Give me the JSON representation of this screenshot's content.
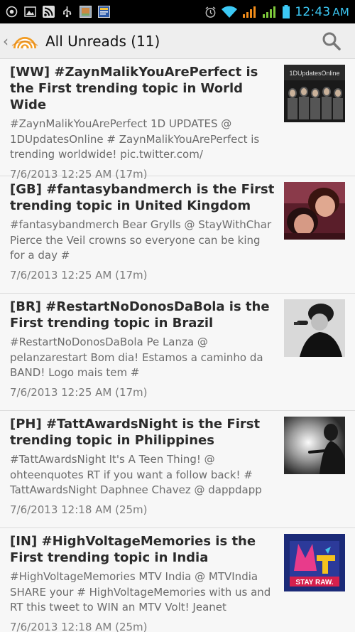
{
  "status_bar": {
    "time": "12:43",
    "ampm": "AM"
  },
  "action_bar": {
    "back_glyph": "‹",
    "title": "All Unreads (11)"
  },
  "items": [
    {
      "title": "[WW] #ZaynMalikYouArePerfect is the First trending topic in World Wide",
      "body": "#ZaynMalikYouArePerfect 1D UPDATES @ 1DUpdatesOnline # ZaynMalikYouArePerfect is trending worldwide! pic.twitter.com/",
      "time": "7/6/2013 12:25 AM (17m)",
      "thumb_text": "1DUpdatesOnline"
    },
    {
      "title": "[GB] #fantasybandmerch is the First trending topic in United Kingdom",
      "body": "#fantasybandmerch Bear Grylls  @ StayWithChar Pierce the Veil crowns so everyone can be king for a day #",
      "time": "7/6/2013 12:25 AM (17m)"
    },
    {
      "title": "[BR] #RestartNoDonosDaBola is the First trending topic in Brazil",
      "body": "#RestartNoDonosDaBola Pe Lanza  @ pelanzarestart Bom dia! Estamos a caminho da BAND! Logo mais tem #",
      "time": "7/6/2013 12:25 AM (17m)"
    },
    {
      "title": "[PH] #TattAwardsNight is the First trending topic in Philippines",
      "body": "#TattAwardsNight It's A Teen Thing!  @ ohteenquotes RT if you want a follow back! # TattAwardsNight Daphnee Chavez  @ dappdapp",
      "time": "7/6/2013 12:18 AM (25m)"
    },
    {
      "title": "[IN] #HighVoltageMemories is the First trending topic in India",
      "body": "#HighVoltageMemories MTV India  @ MTVIndia SHARE your # HighVoltageMemories with us and RT this tweet to WIN an MTV Volt! Jeanet",
      "time": "7/6/2013 12:18 AM (25m)",
      "thumb_text": "STAY RAW."
    }
  ],
  "colors": {
    "status_bar_bg": "#000000",
    "clock": "#3cc9f5",
    "action_bar_bg": "#eeeeee",
    "list_bg": "#f7f7f7",
    "title_text": "#2b2b2b",
    "body_text": "#6b6b6b",
    "logo_orange": "#f29b21"
  },
  "icons": [
    "target-icon",
    "image-icon",
    "rss-icon",
    "usb-icon",
    "photo-icon",
    "news-icon",
    "alarm-icon",
    "wifi-icon",
    "signal-icon",
    "battery-icon",
    "rss-logo-icon",
    "search-icon"
  ]
}
